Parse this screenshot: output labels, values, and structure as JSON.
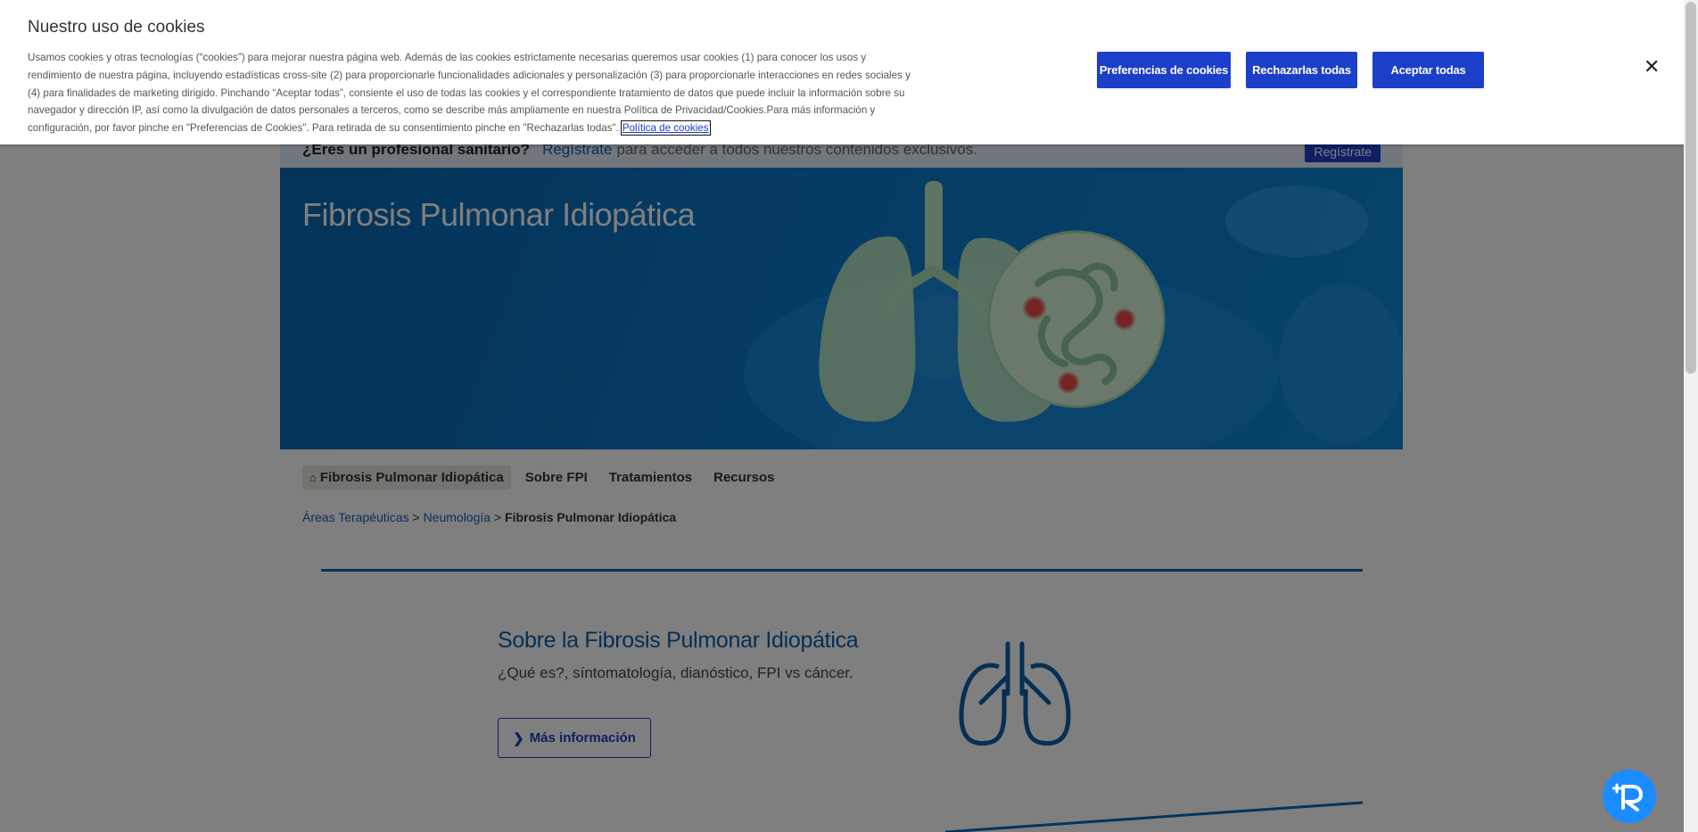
{
  "colors": {
    "brand_blue": "#1c3fc9",
    "link_blue": "#1e5bb8",
    "heading_blue": "#0b5ea8",
    "hero_blue": "#0b78c9",
    "chat_blue": "#1a8cff"
  },
  "pro_bar": {
    "question": "¿Eres un profesional sanitario?",
    "link": "Regístrate",
    "rest": "para acceder a todos nuestros contenidos exclusivos.",
    "button": "Regístrate"
  },
  "hero": {
    "title": "Fibrosis Pulmonar Idiopática",
    "illustration_icon": "lungs-illustration"
  },
  "nav": {
    "home_icon": "home-icon",
    "items": [
      {
        "label": "Fibrosis Pulmonar Idiopática"
      },
      {
        "label": "Sobre FPI"
      },
      {
        "label": "Tratamientos"
      },
      {
        "label": "Recursos"
      }
    ]
  },
  "breadcrumb": {
    "items": [
      "Áreas Terapéuticas",
      "Neumología",
      "Fibrosis Pulmonar Idiopática"
    ],
    "separator": ">"
  },
  "about": {
    "title": "Sobre la Fibrosis Pulmonar Idiopática",
    "subtitle": "¿Qué es?, síntomatología, dianóstico, FPI vs cáncer.",
    "button": "Más información",
    "icon": "lungs-icon"
  },
  "cookie_banner": {
    "title": "Nuestro uso de cookies",
    "body": "Usamos cookies y otras tecnologías (“cookies”) para mejorar nuestra página web. Además de las cookies estrictamente necesarias queremos usar cookies (1) para conocer los usos y rendimiento de nuestra página, incluyendo estadísticas cross-site (2) para proporcionarle funcionalidades adicionales y personalización (3) para proporcionarle interacciones en redes sociales y (4) para finalidades de marketing dirigido. Pinchando “Aceptar todas”, consiente el uso de todas las cookies y el correspondiente tratamiento de datos que puede incluir la información sobre su navegador y dirección IP, así como la divulgación de datos personales a terceros, como se describe más ampliamente en nuestra Política de Privacidad/Cookies.Para más información y configuración, por favor pinche en \"Preferencias de Cookies\". Para retirada de su consentimiento pinche en \"Rechazarlas todas\".",
    "policy_link": "Política de cookies",
    "buttons": {
      "preferences": "Preferencias de cookies",
      "reject": "Rechazarlas todas",
      "accept": "Aceptar todas"
    },
    "close_icon": "close-icon"
  },
  "chat_widget": {
    "icon": "chat-bot-icon"
  }
}
